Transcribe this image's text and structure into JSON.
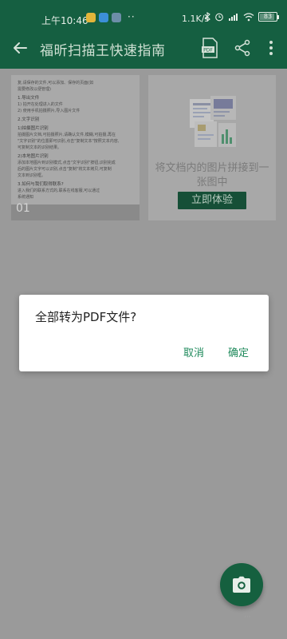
{
  "status_bar": {
    "time": "上午10:46",
    "dots": "··",
    "network_speed": "1.1K/s",
    "battery": "83",
    "battery_level": 0.83,
    "app_icons": [
      "#e2b53a",
      "#3c8fd8",
      "#6d8ea8"
    ]
  },
  "app_bar": {
    "title": "福昕扫描王快速指南",
    "icons": [
      "back-icon",
      "pdf-icon",
      "share-icon",
      "more-icon"
    ]
  },
  "doc_card": {
    "lines": [
      "复,请保存的文件,可以添加、保存的页面(如",
      "需要修改以便管理)",
      "1.导出文件",
      "1) 拍开在处理进入的文件",
      "2) 使用手机拍摄照片,导入图片文件",
      "2.文字识别",
      "1)拍摄图片识别",
      "拍摄图片文档,可拍摄照片,请确认文件,模糊,可拍摄,再在",
      "\"文字识别\"的位置即可识别,点击\"复制文本\"按照文本内容,",
      "可复制文本的识别结果。",
      "2)本地图片识别",
      "添加本地图片到识别模式,点击\"文字识别\"按钮,识别完成",
      "后的图片文字可以识别,点击\"复制\"将文本拷贝,可复制",
      "文本到识别框。",
      "3.如何与我们取得联系?",
      "进入我们的联系方式的,联系在线客服,可以通过",
      "系统通知"
    ],
    "counter": "01"
  },
  "promo_card": {
    "text": "将文档内的图片拼接到一张图中",
    "button_label": "立即体验"
  },
  "dialog": {
    "message": "全部转为PDF文件?",
    "cancel_label": "取消",
    "ok_label": "确定"
  },
  "fab": {
    "icon": "camera-icon"
  },
  "watermark": "···",
  "colors": {
    "app_bar": "#155f41",
    "accent": "#1f8a5c",
    "scrim_background": "#9a9a9a"
  }
}
